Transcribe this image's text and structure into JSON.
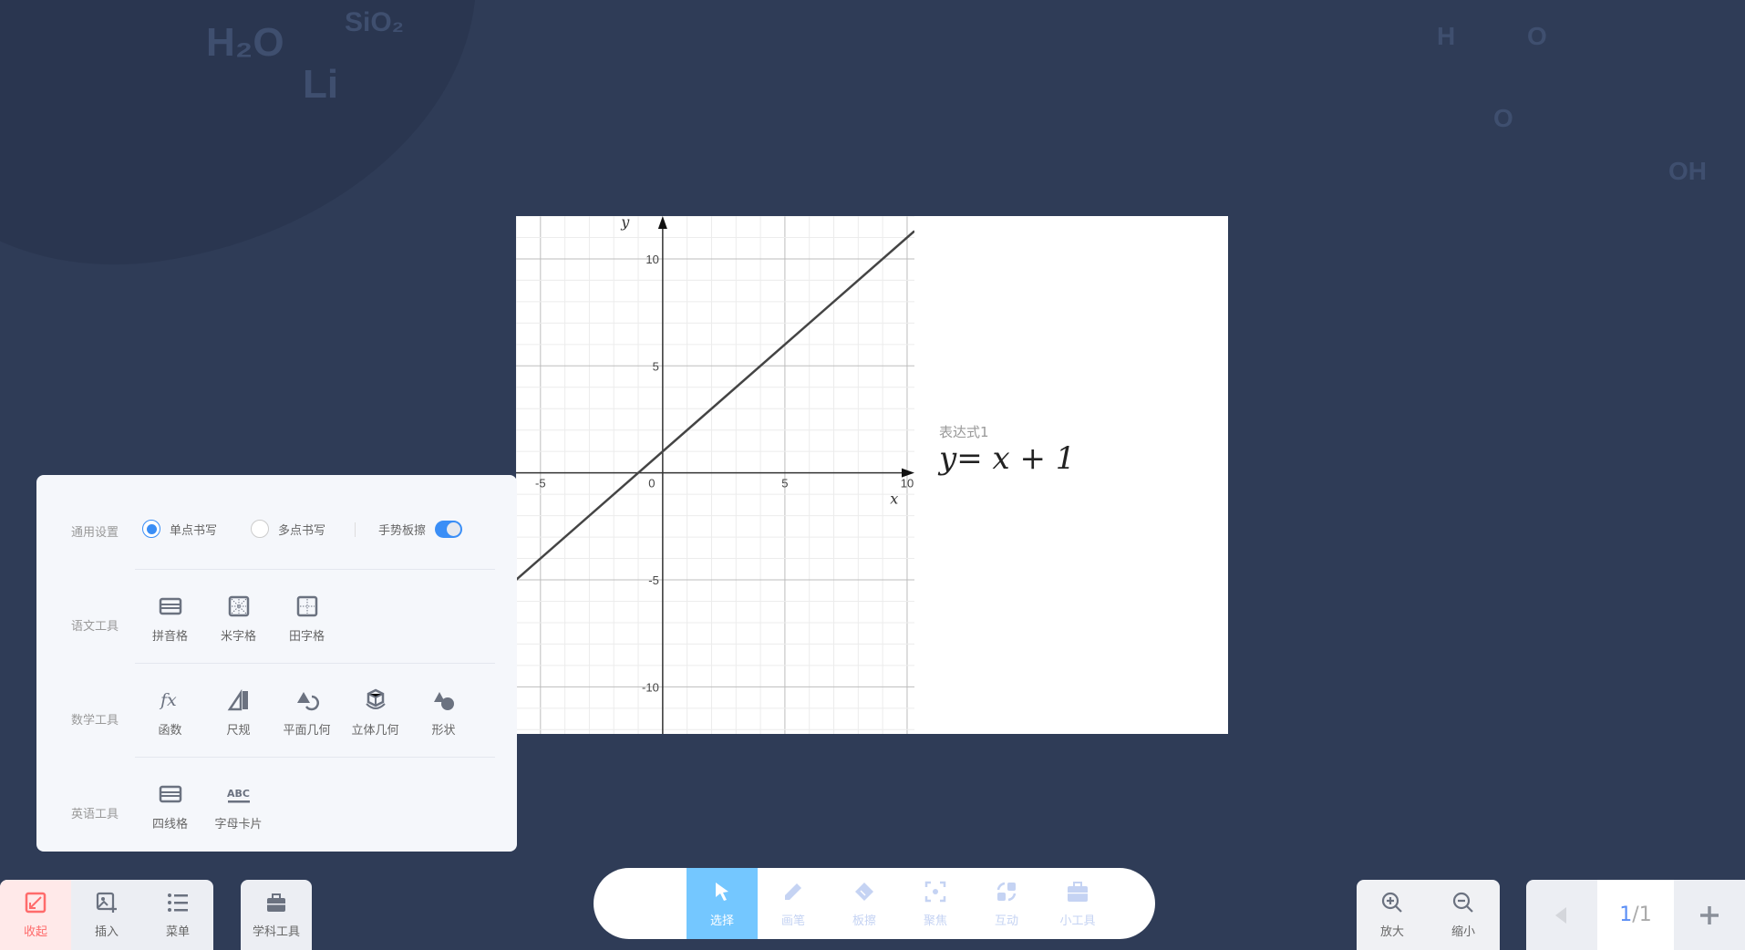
{
  "background": {
    "decorations": [
      "H₂O",
      "SiO₂",
      "Li",
      "H",
      "O",
      "O",
      "OH"
    ]
  },
  "graph": {
    "chart_data": {
      "type": "line",
      "title": "",
      "xlabel": "x",
      "ylabel": "y",
      "xlim": [
        -6,
        10.3
      ],
      "ylim": [
        -12.2,
        12
      ],
      "grid": true,
      "xticks": [
        -5,
        0,
        5,
        10
      ],
      "yticks": [
        10,
        5,
        -5,
        -10
      ],
      "series": [
        {
          "expression": "y = x + 1",
          "slope": 1,
          "intercept": 1
        }
      ]
    },
    "expression_label": "表达式1",
    "expression": "y= x + 1"
  },
  "panel": {
    "general": {
      "label": "通用设置",
      "single": "单点书写",
      "multi": "多点书写",
      "gesture": "手势板擦",
      "single_selected": true,
      "gesture_on": true
    },
    "chinese": {
      "label": "语文工具",
      "items": [
        "拼音格",
        "米字格",
        "田字格"
      ]
    },
    "math": {
      "label": "数学工具",
      "items": [
        "函数",
        "尺规",
        "平面几何",
        "立体几何",
        "形状"
      ]
    },
    "english": {
      "label": "英语工具",
      "items": [
        "四线格",
        "字母卡片"
      ],
      "abc": "ABC"
    }
  },
  "bottom": {
    "left": [
      "收起",
      "插入",
      "菜单"
    ],
    "subject": "学科工具",
    "tools": [
      "选择",
      "画笔",
      "板擦",
      "聚焦",
      "互动",
      "小工具"
    ],
    "active_tool": "选择",
    "zoom": [
      "放大",
      "缩小"
    ],
    "page": {
      "current": "1",
      "total": "/1"
    }
  },
  "colors": {
    "accent": "#3a8ef6",
    "active_tool": "#74c7ff",
    "collapse": "#ff6b6b"
  }
}
